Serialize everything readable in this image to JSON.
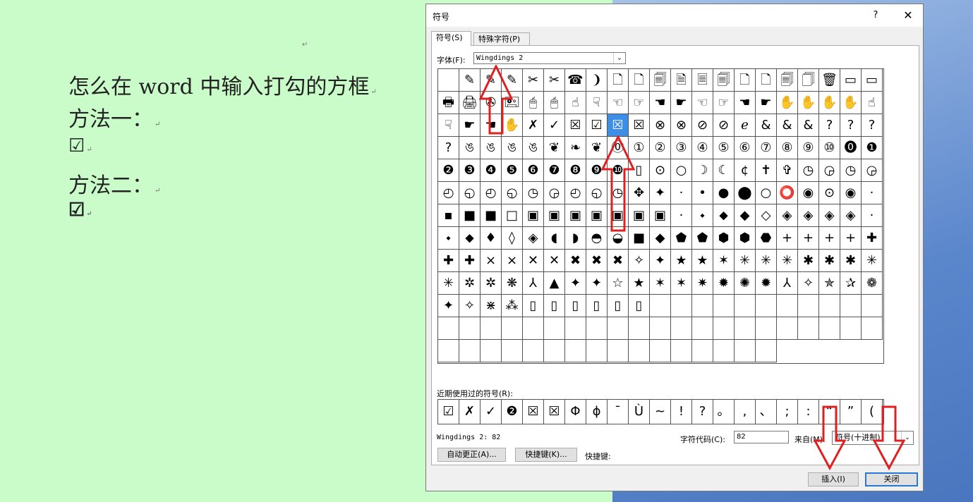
{
  "document": {
    "lines": [
      "怎么在 word 中输入打勾的方框",
      "方法一：",
      "☑",
      "方法二：",
      "☑"
    ],
    "para_mark": "↵"
  },
  "dialog": {
    "title": "符号",
    "help": "?",
    "close_x": "✕",
    "tabs": [
      "符号(S)",
      "特殊字符(P)"
    ],
    "font_label": "字体(F):",
    "font_value": "Wingdings 2",
    "dropdown_arrow": "⌄",
    "symbols": [
      "",
      "✎",
      "✎",
      "✎",
      "✂",
      "✂",
      "☎",
      "❩",
      "🗋",
      "🗋",
      "🗐",
      "🗎",
      "🗏",
      "🗐",
      "🗋",
      "🗋",
      "🗐",
      "🗍",
      "🗑",
      "▭",
      "▭",
      "🖶",
      "🖨",
      "✇",
      "🖭",
      "🖱",
      "🖱",
      "☝",
      "☟",
      "☜",
      "☞",
      "☚",
      "☛",
      "☜",
      "☞",
      "☚",
      "☛",
      "✋",
      "✋",
      "✋",
      "✋",
      "☝",
      "☟",
      "☛",
      "☚",
      "✋",
      "✗",
      "✓",
      "☒",
      "☑",
      "☒",
      "☒",
      "⊗",
      "⊗",
      "⊘",
      "⊘",
      "ℯ",
      "&",
      "&",
      "&",
      "?",
      "?",
      "?",
      "?",
      "ঙ",
      "ঙ",
      "ঙ",
      "ঙ",
      "❦",
      "❧",
      "❦",
      "⓪",
      "①",
      "②",
      "③",
      "④",
      "⑤",
      "⑥",
      "⑦",
      "⑧",
      "⑨",
      "⑩",
      "⓿",
      "❶",
      "❷",
      "❸",
      "❹",
      "❺",
      "❻",
      "❼",
      "❽",
      "❾",
      "❿",
      "▯",
      "⊙",
      "○",
      "☽",
      "☾",
      "¢",
      "✝",
      "✞",
      "◷",
      "◶",
      "◷",
      "◶",
      "◴",
      "◵",
      "◴",
      "◵",
      "◷",
      "◶",
      "◴",
      "◵",
      "◷",
      "✥",
      "✦",
      "·",
      "•",
      "●",
      "⬤",
      "○",
      "⭕",
      "◉",
      "⊙",
      "◉",
      "·",
      "▪",
      "■",
      "■",
      "□",
      "▣",
      "▣",
      "▣",
      "▣",
      "▣",
      "▣",
      "▣",
      "·",
      "⬩",
      "⬥",
      "◆",
      "◇",
      "◈",
      "◈",
      "◈",
      "◈",
      "·",
      "⬩",
      "⬥",
      "♦",
      "◊",
      "◈",
      "◖",
      "◗",
      "◓",
      "◒",
      "■",
      "◆",
      "⬟",
      "⬟",
      "⬢",
      "⬢",
      "⬣",
      "+",
      "+",
      "+",
      "+",
      "✚",
      "✚",
      "✚",
      "×",
      "×",
      "✕",
      "✕",
      "✖",
      "✖",
      "✖",
      "✧",
      "✦",
      "★",
      "★",
      "✶",
      "✳",
      "✳",
      "✳",
      "✱",
      "✱",
      "✱",
      "✳",
      "✳",
      "✲",
      "✲",
      "❋",
      "⅄",
      "▲",
      "✦",
      "✦",
      "☆",
      "★",
      "✶",
      "✶",
      "✷",
      "✹",
      "✺",
      "✹",
      "⅄",
      "✧",
      "✯",
      "✰",
      "❁",
      "✦",
      "✧",
      "⋇",
      "⁂",
      "▯",
      "▯",
      "▯",
      "▯",
      "▯",
      "▯",
      "",
      "",
      "",
      "",
      "",
      "",
      "",
      "",
      "",
      "",
      "",
      "",
      "",
      "",
      "",
      "",
      "",
      "",
      "",
      "",
      "",
      "",
      "",
      "",
      "",
      "",
      "",
      "",
      "",
      "",
      "",
      "",
      "",
      "",
      "",
      "",
      "",
      "",
      "",
      "",
      "",
      "",
      "",
      "",
      "",
      "",
      "",
      ""
    ],
    "selected_index": 50,
    "recent_label": "近期使用过的符号(R):",
    "recent": [
      "☑",
      "✗",
      "✓",
      "❷",
      "☒",
      "☒",
      "Φ",
      "ϕ",
      "¯",
      "Ù",
      "~",
      "!",
      "?",
      "。",
      ",",
      "、",
      ";",
      ":",
      "“",
      "”",
      "("
    ],
    "char_desc": "Wingdings 2: 82",
    "code_label": "字符代码(C):",
    "code_value": "82",
    "from_label": "来自(M):",
    "from_value": "符号(十进制)",
    "autocorrect_btn": "自动更正(A)...",
    "shortcut_btn": "快捷键(K)...",
    "shortcut_label": "快捷键:",
    "insert_btn": "插入(I)",
    "close_btn": "关闭"
  },
  "colors": {
    "doc_bg": "#c9fcc9",
    "selection": "#3d8ee6",
    "annotation_arrow": "#e02020"
  }
}
